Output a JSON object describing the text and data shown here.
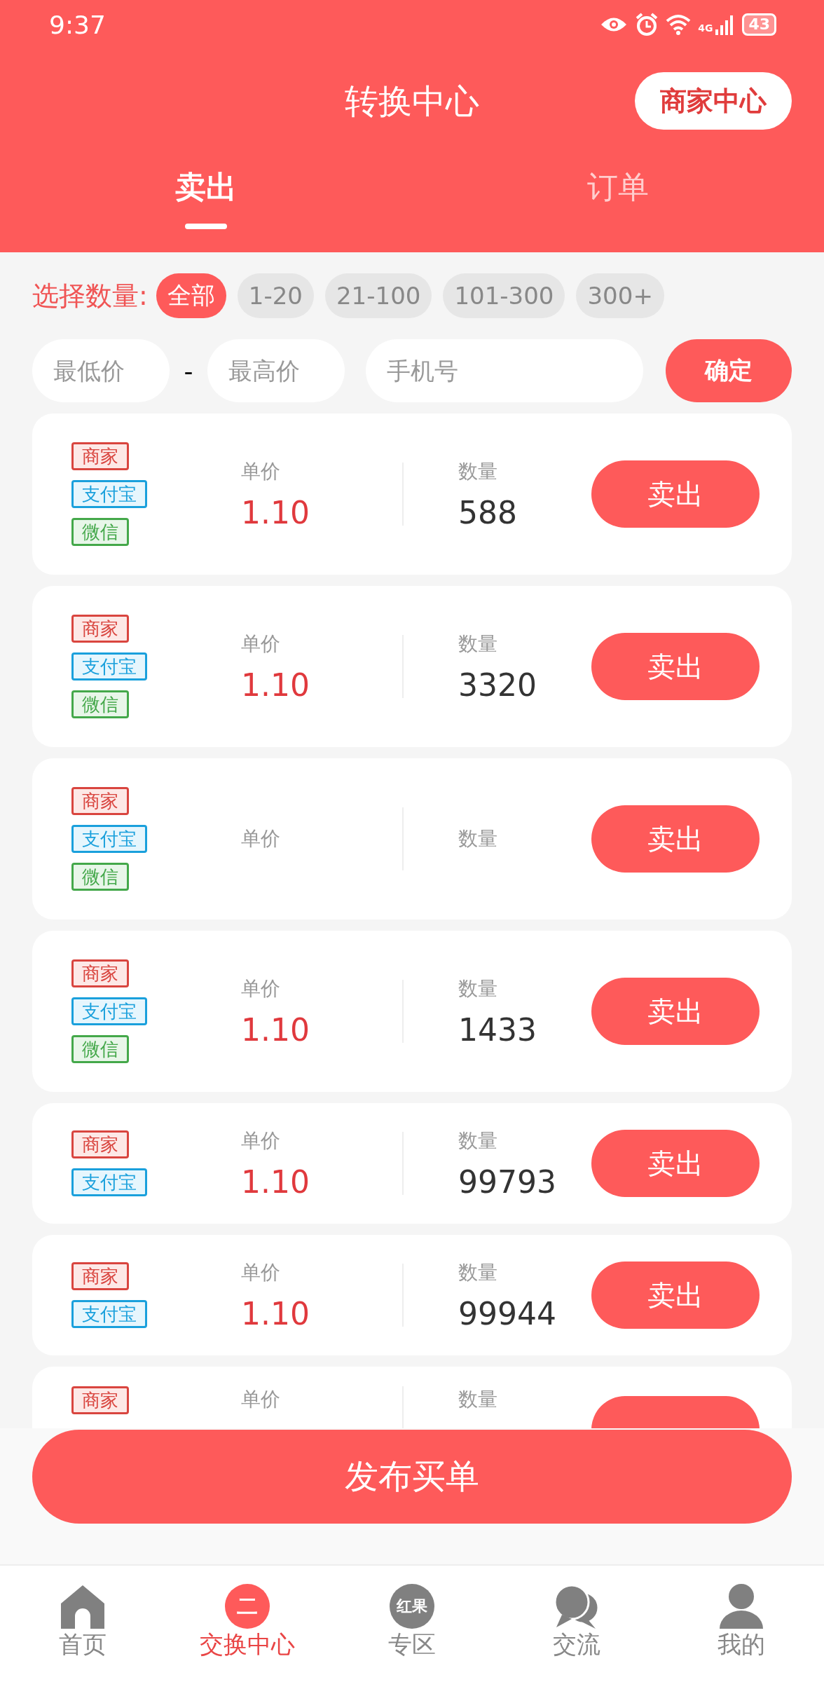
{
  "status_bar": {
    "time": "9:37",
    "network": "4G",
    "battery": "43"
  },
  "header": {
    "title": "转换中心",
    "action": "商家中心"
  },
  "tabs": [
    {
      "label": "卖出",
      "selected": true
    },
    {
      "label": "订单",
      "selected": false
    }
  ],
  "filter": {
    "label": "选择数量:",
    "chips": [
      {
        "label": "全部",
        "selected": true
      },
      {
        "label": "1-20",
        "selected": false
      },
      {
        "label": "21-100",
        "selected": false
      },
      {
        "label": "101-300",
        "selected": false
      },
      {
        "label": "300+",
        "selected": false
      }
    ]
  },
  "search": {
    "min_price": {
      "placeholder": "最低价"
    },
    "separator": "-",
    "max_price": {
      "placeholder": "最高价"
    },
    "phone": {
      "placeholder": "手机号"
    },
    "confirm": "确定"
  },
  "orders": [
    {
      "tags": [
        {
          "label": "商家",
          "kind": "merchant"
        },
        {
          "label": "支付宝",
          "kind": "alipay"
        },
        {
          "label": "微信",
          "kind": "wechat"
        }
      ],
      "price_label": "单价",
      "price": "1.10",
      "quantity_label": "数量",
      "quantity": "588",
      "button": "卖出"
    },
    {
      "tags": [
        {
          "label": "商家",
          "kind": "merchant"
        },
        {
          "label": "支付宝",
          "kind": "alipay"
        },
        {
          "label": "微信",
          "kind": "wechat"
        }
      ],
      "price_label": "单价",
      "price": "1.10",
      "quantity_label": "数量",
      "quantity": "3320",
      "button": "卖出"
    },
    {
      "tags": [
        {
          "label": "商家",
          "kind": "merchant"
        },
        {
          "label": "支付宝",
          "kind": "alipay"
        },
        {
          "label": "微信",
          "kind": "wechat"
        }
      ],
      "price_label": "单价",
      "quantity_label": "数量",
      "button": "卖出"
    },
    {
      "tags": [
        {
          "label": "商家",
          "kind": "merchant"
        },
        {
          "label": "支付宝",
          "kind": "alipay"
        },
        {
          "label": "微信",
          "kind": "wechat"
        }
      ],
      "price_label": "单价",
      "price": "1.10",
      "quantity_label": "数量",
      "quantity": "1433",
      "button": "卖出"
    },
    {
      "tags": [
        {
          "label": "商家",
          "kind": "merchant"
        },
        {
          "label": "支付宝",
          "kind": "alipay"
        }
      ],
      "price_label": "单价",
      "price": "1.10",
      "quantity_label": "数量",
      "quantity": "99793",
      "button": "卖出"
    },
    {
      "tags": [
        {
          "label": "商家",
          "kind": "merchant"
        },
        {
          "label": "支付宝",
          "kind": "alipay"
        }
      ],
      "price_label": "单价",
      "price": "1.10",
      "quantity_label": "数量",
      "quantity": "99944",
      "button": "卖出"
    },
    {
      "tags": [
        {
          "label": "商家",
          "kind": "merchant"
        }
      ],
      "price_label": "单价",
      "quantity_label": "数量",
      "button_cut_off": true
    }
  ],
  "publish_button": "发布买单",
  "nav": [
    {
      "label": "首页",
      "kind": "home",
      "selected": false
    },
    {
      "label": "交换中心",
      "kind": "badge",
      "icon_text": "二",
      "selected": true
    },
    {
      "label": "专区",
      "kind": "badge",
      "icon_text": "红果",
      "selected": false
    },
    {
      "label": "交流",
      "kind": "chat",
      "selected": false
    },
    {
      "label": "我的",
      "kind": "user",
      "selected": false
    }
  ]
}
